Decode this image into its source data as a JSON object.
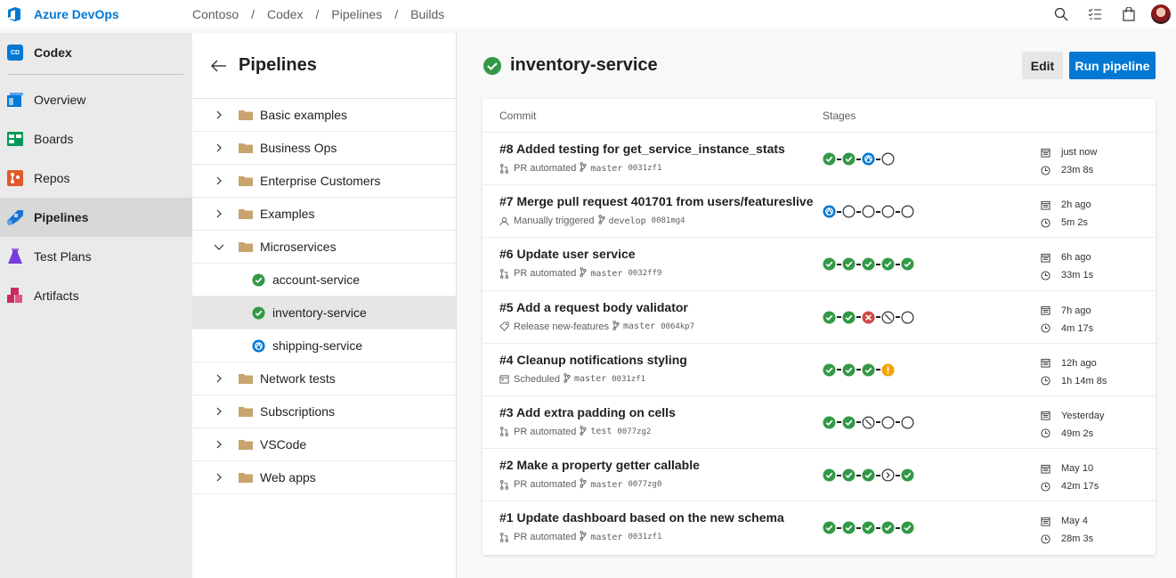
{
  "app": {
    "name": "Azure DevOps"
  },
  "breadcrumb": [
    "Contoso",
    "Codex",
    "Pipelines",
    "Builds"
  ],
  "topbar_icons": [
    "search-icon",
    "task-list-icon",
    "shopping-bag-icon",
    "user-avatar"
  ],
  "project": {
    "badge": "CD",
    "name": "Codex"
  },
  "nav": [
    {
      "label": "Overview",
      "icon": "overview-icon",
      "color": "#0078d4",
      "selected": false
    },
    {
      "label": "Boards",
      "icon": "boards-icon",
      "color": "#009a57",
      "selected": false
    },
    {
      "label": "Repos",
      "icon": "repos-icon",
      "color": "#e05b2c",
      "selected": false
    },
    {
      "label": "Pipelines",
      "icon": "pipelines-icon",
      "color": "#1a73d1",
      "selected": true
    },
    {
      "label": "Test Plans",
      "icon": "test-plans-icon",
      "color": "#773adc",
      "selected": false
    },
    {
      "label": "Artifacts",
      "icon": "artifacts-icon",
      "color": "#cc2a5a",
      "selected": false
    }
  ],
  "panel": {
    "title": "Pipelines",
    "tree": [
      {
        "label": "Basic examples",
        "type": "folder",
        "expanded": false
      },
      {
        "label": "Business Ops",
        "type": "folder",
        "expanded": false
      },
      {
        "label": "Enterprise Customers",
        "type": "folder",
        "expanded": false
      },
      {
        "label": "Examples",
        "type": "folder",
        "expanded": false
      },
      {
        "label": "Microservices",
        "type": "folder",
        "expanded": true
      },
      {
        "label": "account-service",
        "type": "pipeline",
        "status": "success",
        "selected": false
      },
      {
        "label": "inventory-service",
        "type": "pipeline",
        "status": "success",
        "selected": true
      },
      {
        "label": "shipping-service",
        "type": "pipeline",
        "status": "running",
        "selected": false
      },
      {
        "label": "Network tests",
        "type": "folder",
        "expanded": false
      },
      {
        "label": "Subscriptions",
        "type": "folder",
        "expanded": false
      },
      {
        "label": "VSCode",
        "type": "folder",
        "expanded": false
      },
      {
        "label": "Web apps",
        "type": "folder",
        "expanded": false
      }
    ]
  },
  "main": {
    "title": "inventory-service",
    "title_status": "success",
    "edit_label": "Edit",
    "run_label": "Run pipeline",
    "columns": {
      "commit": "Commit",
      "stages": "Stages"
    },
    "runs": [
      {
        "title": "#8 Added testing for get_service_instance_stats",
        "trigger_icon": "pull-request-icon",
        "trigger": "PR automated",
        "branch": "master",
        "commit": "0031zf1",
        "stages": [
          "success",
          "success",
          "running",
          "pending"
        ],
        "when": "just now",
        "duration": "23m 8s"
      },
      {
        "title": "#7 Merge pull request 401701 from users/featureslive",
        "trigger_icon": "person-icon",
        "trigger": "Manually triggered",
        "branch": "develop",
        "commit": "0081mg4",
        "stages": [
          "running",
          "pending",
          "pending",
          "pending",
          "pending"
        ],
        "when": "2h ago",
        "duration": "5m 2s"
      },
      {
        "title": "#6 Update user service",
        "trigger_icon": "pull-request-icon",
        "trigger": "PR automated",
        "branch": "master",
        "commit": "0032ff9",
        "stages": [
          "success",
          "success",
          "success",
          "success",
          "success"
        ],
        "when": "6h ago",
        "duration": "33m 1s"
      },
      {
        "title": "#5 Add a request body validator",
        "trigger_icon": "tag-icon",
        "trigger": "Release new-features",
        "branch": "master",
        "commit": "0064kp7",
        "stages": [
          "success",
          "success",
          "failed",
          "canceled",
          "pending"
        ],
        "when": "7h ago",
        "duration": "4m 17s"
      },
      {
        "title": "#4 Cleanup notifications styling",
        "trigger_icon": "calendar-icon",
        "trigger": "Scheduled",
        "branch": "master",
        "commit": "0031zf1",
        "stages": [
          "success",
          "success",
          "success",
          "warning"
        ],
        "when": "12h ago",
        "duration": "1h 14m 8s"
      },
      {
        "title": "#3 Add extra padding on cells",
        "trigger_icon": "pull-request-icon",
        "trigger": "PR automated",
        "branch": "test",
        "commit": "0077zg2",
        "stages": [
          "success",
          "success",
          "canceled",
          "pending",
          "pending"
        ],
        "when": "Yesterday",
        "duration": "49m 2s"
      },
      {
        "title": "#2 Make a property getter callable",
        "trigger_icon": "pull-request-icon",
        "trigger": "PR automated",
        "branch": "master",
        "commit": "0077zg0",
        "stages": [
          "success",
          "success",
          "success",
          "skipped",
          "success"
        ],
        "when": "May 10",
        "duration": "42m 17s"
      },
      {
        "title": "#1 Update dashboard based on the new schema",
        "trigger_icon": "pull-request-icon",
        "trigger": "PR automated",
        "branch": "master",
        "commit": "0031zf1",
        "stages": [
          "success",
          "success",
          "success",
          "success",
          "success"
        ],
        "when": "May 4",
        "duration": "28m 3s"
      }
    ]
  },
  "colors": {
    "accent": "#0078d4",
    "success": "#339947",
    "failed": "#cd4a45",
    "warning": "#f3a200",
    "running": "#0078d4"
  }
}
